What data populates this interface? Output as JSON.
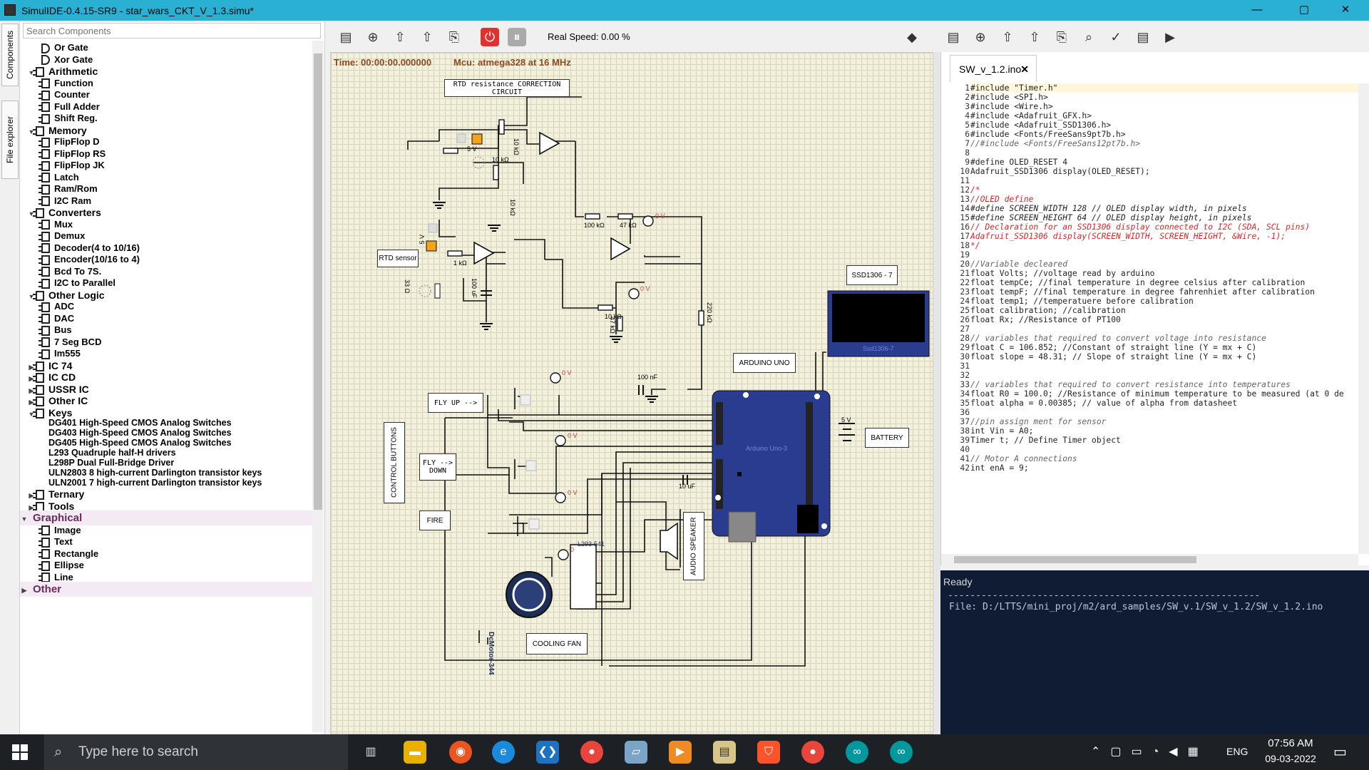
{
  "window": {
    "title": "SimulIDE-0.4.15-SR9  -  star_wars_CKT_V_1.3.simu*",
    "min": "—",
    "max": "▢",
    "close": "✕"
  },
  "sidetabs": {
    "components": "Components",
    "file_explorer": "File explorer"
  },
  "search": {
    "placeholder": "Search Components"
  },
  "tree": [
    {
      "label": "Or Gate",
      "kind": "item",
      "icon": "gate-icon"
    },
    {
      "label": "Xor Gate",
      "kind": "item",
      "icon": "gate-icon"
    },
    {
      "label": "Arithmetic",
      "kind": "cat"
    },
    {
      "label": "Function",
      "kind": "item",
      "icon": "chip-icon"
    },
    {
      "label": "Counter",
      "kind": "item",
      "icon": "chip-icon"
    },
    {
      "label": "Full Adder",
      "kind": "item",
      "icon": "chip-icon"
    },
    {
      "label": "Shift Reg.",
      "kind": "item",
      "icon": "chip-icon"
    },
    {
      "label": "Memory",
      "kind": "cat"
    },
    {
      "label": "FlipFlop D",
      "kind": "item",
      "icon": "chip-icon"
    },
    {
      "label": "FlipFlop RS",
      "kind": "item",
      "icon": "chip-icon"
    },
    {
      "label": "FlipFlop JK",
      "kind": "item",
      "icon": "chip-icon"
    },
    {
      "label": "Latch",
      "kind": "item",
      "icon": "chip-icon"
    },
    {
      "label": "Ram/Rom",
      "kind": "item",
      "icon": "chip-icon"
    },
    {
      "label": "I2C Ram",
      "kind": "item",
      "icon": "chip-icon"
    },
    {
      "label": "Converters",
      "kind": "cat"
    },
    {
      "label": "Mux",
      "kind": "item",
      "icon": "chip-icon"
    },
    {
      "label": "Demux",
      "kind": "item",
      "icon": "chip-icon"
    },
    {
      "label": "Decoder(4 to 10/16)",
      "kind": "item",
      "icon": "chip-icon"
    },
    {
      "label": "Encoder(10/16 to 4)",
      "kind": "item",
      "icon": "chip-icon"
    },
    {
      "label": "Bcd To 7S.",
      "kind": "item",
      "icon": "chip-icon"
    },
    {
      "label": "I2C to Parallel",
      "kind": "item",
      "icon": "chip-icon"
    },
    {
      "label": "Other Logic",
      "kind": "cat"
    },
    {
      "label": "ADC",
      "kind": "item",
      "icon": "chip-icon"
    },
    {
      "label": "DAC",
      "kind": "item",
      "icon": "chip-icon"
    },
    {
      "label": "Bus",
      "kind": "item",
      "icon": "chip-icon"
    },
    {
      "label": "7 Seg BCD",
      "kind": "item",
      "icon": "chip-icon"
    },
    {
      "label": "Im555",
      "kind": "item",
      "icon": "chip-icon"
    },
    {
      "label": "IC 74",
      "kind": "cat-closed"
    },
    {
      "label": "IC CD",
      "kind": "cat-closed"
    },
    {
      "label": "USSR IC",
      "kind": "cat-closed"
    },
    {
      "label": "Other IC",
      "kind": "cat-closed"
    },
    {
      "label": "Keys",
      "kind": "cat"
    },
    {
      "label": "DG401 High-Speed CMOS Analog Switches",
      "kind": "sub"
    },
    {
      "label": "DG403 High-Speed CMOS Analog Switches",
      "kind": "sub"
    },
    {
      "label": "DG405 High-Speed CMOS Analog Switches",
      "kind": "sub"
    },
    {
      "label": "L293 Quadruple half-H drivers",
      "kind": "sub"
    },
    {
      "label": "L298P Dual Full-Bridge Driver",
      "kind": "sub"
    },
    {
      "label": "ULN2803 8 high-current Darlington transistor keys",
      "kind": "sub"
    },
    {
      "label": "ULN2001 7 high-current Darlington transistor keys",
      "kind": "sub"
    },
    {
      "label": "Ternary",
      "kind": "cat-closed"
    },
    {
      "label": "Tools",
      "kind": "cat-closed"
    },
    {
      "label": "Graphical",
      "kind": "group"
    },
    {
      "label": "Image",
      "kind": "item",
      "icon": "image-icon"
    },
    {
      "label": "Text",
      "kind": "item",
      "icon": "text-icon"
    },
    {
      "label": "Rectangle",
      "kind": "item",
      "icon": "rectangle-icon"
    },
    {
      "label": "Ellipse",
      "kind": "item",
      "icon": "ellipse-icon"
    },
    {
      "label": "Line",
      "kind": "item",
      "icon": "line-icon"
    },
    {
      "label": "Other",
      "kind": "group-closed"
    }
  ],
  "toolbar": {
    "speed": "Real Speed: 0.00 %"
  },
  "status": {
    "time": "Time: 00:00:00.000000",
    "mcu": "Mcu: atmega328 at 16 MHz"
  },
  "circuit": {
    "labels": {
      "rtd_title": "RTD resistance CORRECTION CIRCUIT",
      "rtd_sensor": "RTD sensor",
      "fly_up": "FLY UP -->",
      "fly_down": "FLY -->\nDOWN",
      "fire": "FIRE",
      "control": "CONTROL BUTTONS",
      "cooling": "COOLING FAN",
      "audio": "AUDIO SPEAKER",
      "arduino": "ARDUINO UNO",
      "ssd": "SSD1306 - 7",
      "battery": "BATTERY",
      "dcmotor": "DcMotor-344",
      "l293": "L293-541",
      "arduino_chip": "Arduino Uno-3",
      "ssd_chip": "Ssd1306-7"
    },
    "values": {
      "v5a": "5 V",
      "v5b": "5 V",
      "r10ka": "10 kΩ",
      "r10kb": "10 kΩ",
      "r10kc": "10 kΩ",
      "r10kd": "10 kΩ",
      "r1k": "1 kΩ",
      "r100k": "100 kΩ",
      "r47k": "47 kΩ",
      "r47kb": "47 kΩ",
      "r220k": "220 kΩ",
      "r33": "33 Ω",
      "c100u": "100 uF",
      "c100n": "100 nF",
      "c10u": "10 uF",
      "p0v_a": "0 V",
      "p0v_b": "0 V",
      "p0v_c": "0 V",
      "p0v_d": "0 V",
      "p0v_e": "0 V",
      "p0v_f": "0",
      "bat": "5 V"
    }
  },
  "editor": {
    "tab": "SW_v_1.2.ino",
    "tab_close": "✕",
    "lines": [
      "#include \"Timer.h\"",
      "#include <SPI.h>",
      "#include <Wire.h>",
      "#include <Adafruit_GFX.h>",
      "#include <Adafruit_SSD1306.h>",
      "#include <Fonts/FreeSans9pt7b.h>",
      "//#include <Fonts/FreeSans12pt7b.h>",
      "",
      "#define OLED_RESET 4",
      "Adafruit_SSD1306 display(OLED_RESET);",
      "",
      "/*",
      "//OLED define",
      "#define SCREEN_WIDTH 128 // OLED display width, in pixels",
      "#define SCREEN_HEIGHT 64 // OLED display height, in pixels",
      "// Declaration for an SSD1306 display connected to I2C (SDA, SCL pins)",
      "Adafruit_SSD1306 display(SCREEN_WIDTH, SCREEN_HEIGHT, &Wire, -1);",
      "*/",
      "",
      "//Variable decleared",
      "float Volts; //voltage read by arduino",
      "float tempCe; //final temperature in degree celsius after calibration",
      "float tempF; //final temperature in degree fahrenhiet after calibration",
      "float temp1; //temperatuere before calibration",
      "float calibration; //calibration",
      "float Rx; //Resistance of PT100",
      "",
      "// variables that required to convert voltage into resistance",
      "float C = 106.852; //Constant of straight line (Y = mx + C)",
      "float slope = 48.31; // Slope of straight line (Y = mx + C)",
      "",
      "",
      "// variables that required to convert resistance into temperatures",
      "float R0 = 100.0; //Resistance of minimum temperature to be measured (at 0 de",
      "float alpha = 0.00385; // value of alpha from datasheet",
      "",
      "//pin assign ment for sensor",
      "int Vin = A0;",
      "Timer t; // Define Timer object",
      "",
      "// Motor A connections",
      "int enA = 9;"
    ]
  },
  "console": {
    "status": "Ready",
    "separator": "--------------------------------------------------------",
    "file": "File: D:/LTTS/mini_proj/m2/ard_samples/SW_v.1/SW_v_1.2/SW_v_1.2.ino"
  },
  "taskbar": {
    "search_placeholder": "Type here to search",
    "lang": "ENG",
    "time": "07:56 AM",
    "date": "09-03-2022"
  }
}
